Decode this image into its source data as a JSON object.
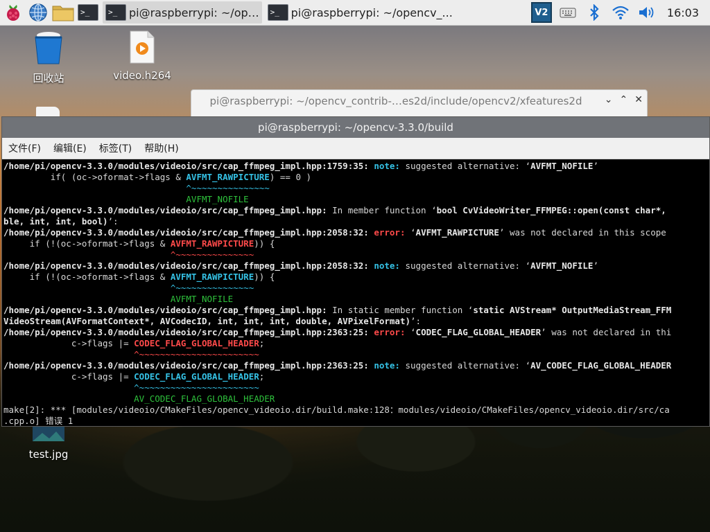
{
  "taskbar": {
    "tasks": [
      {
        "label": "pi@raspberrypi: ~/op…",
        "active": true
      },
      {
        "label": "pi@raspberrypi: ~/opencv_...",
        "active": false
      }
    ],
    "clock": "16:03",
    "icons": [
      "raspberry-menu-icon",
      "web-browser-icon",
      "file-manager-icon",
      "terminal-icon",
      "vnc-icon",
      "keyboard-icon",
      "bluetooth-icon",
      "wifi-icon",
      "volume-icon"
    ]
  },
  "desktop": {
    "icons": [
      {
        "label": "回收站",
        "icon": "trash-icon"
      },
      {
        "label": "video.h264",
        "icon": "video-file-icon"
      },
      {
        "label": "test.jpg",
        "icon": "image-file-icon"
      }
    ]
  },
  "bg_window": {
    "title": "pi@raspberrypi: ~/opencv_contrib-…es2d/include/opencv2/xfeatures2d"
  },
  "terminal": {
    "title": "pi@raspberrypi: ~/opencv-3.3.0/build",
    "menu": [
      "文件(F)",
      "编辑(E)",
      "标签(T)",
      "帮助(H)"
    ],
    "lines": [
      [
        {
          "t": "/home/pi/opencv-3.3.0/modules/videoio/src/cap_ffmpeg_impl.hpp:1759:35: ",
          "c": "b"
        },
        {
          "t": "note:",
          "c": "note"
        },
        {
          "t": " suggested alternative: ‘",
          "c": ""
        },
        {
          "t": "AVFMT_NOFILE",
          "c": "b"
        },
        {
          "t": "’",
          "c": ""
        }
      ],
      [
        {
          "t": "         if( (oc->oformat->flags & ",
          "c": ""
        },
        {
          "t": "AVFMT_RAWPICTURE",
          "c": "hlc"
        },
        {
          "t": ") == 0 )",
          "c": ""
        }
      ],
      [
        {
          "t": "                                   ^~~~~~~~~~~~~~~~",
          "c": "c"
        }
      ],
      [
        {
          "t": "                                   AVFMT_NOFILE",
          "c": "gr"
        }
      ],
      [
        {
          "t": "/home/pi/opencv-3.3.0/modules/videoio/src/cap_ffmpeg_impl.hpp:",
          "c": "b"
        },
        {
          "t": " In member function ‘",
          "c": ""
        },
        {
          "t": "bool CvVideoWriter_FFMPEG::open(const char*, ",
          "c": "b"
        }
      ],
      [
        {
          "t": "ble, int, int, bool)",
          "c": "b"
        },
        {
          "t": "’:",
          "c": ""
        }
      ],
      [
        {
          "t": "/home/pi/opencv-3.3.0/modules/videoio/src/cap_ffmpeg_impl.hpp:2058:32: ",
          "c": "b"
        },
        {
          "t": "error:",
          "c": "err"
        },
        {
          "t": " ‘",
          "c": ""
        },
        {
          "t": "AVFMT_RAWPICTURE",
          "c": "b"
        },
        {
          "t": "’ was not declared in this scope",
          "c": ""
        }
      ],
      [
        {
          "t": "     if (!(oc->oformat->flags & ",
          "c": ""
        },
        {
          "t": "AVFMT_RAWPICTURE",
          "c": "hlr"
        },
        {
          "t": ")) {",
          "c": ""
        }
      ],
      [
        {
          "t": "                                ^~~~~~~~~~~~~~~~",
          "c": "r"
        }
      ],
      [
        {
          "t": "/home/pi/opencv-3.3.0/modules/videoio/src/cap_ffmpeg_impl.hpp:2058:32: ",
          "c": "b"
        },
        {
          "t": "note:",
          "c": "note"
        },
        {
          "t": " suggested alternative: ‘",
          "c": ""
        },
        {
          "t": "AVFMT_NOFILE",
          "c": "b"
        },
        {
          "t": "’",
          "c": ""
        }
      ],
      [
        {
          "t": "     if (!(oc->oformat->flags & ",
          "c": ""
        },
        {
          "t": "AVFMT_RAWPICTURE",
          "c": "hlc"
        },
        {
          "t": ")) {",
          "c": ""
        }
      ],
      [
        {
          "t": "                                ^~~~~~~~~~~~~~~~",
          "c": "c"
        }
      ],
      [
        {
          "t": "                                AVFMT_NOFILE",
          "c": "gr"
        }
      ],
      [
        {
          "t": "/home/pi/opencv-3.3.0/modules/videoio/src/cap_ffmpeg_impl.hpp:",
          "c": "b"
        },
        {
          "t": " In static member function ‘",
          "c": ""
        },
        {
          "t": "static AVStream* OutputMediaStream_FFM",
          "c": "b"
        }
      ],
      [
        {
          "t": "VideoStream(AVFormatContext*, AVCodecID, int, int, int, double, AVPixelFormat)",
          "c": "b"
        },
        {
          "t": "’:",
          "c": ""
        }
      ],
      [
        {
          "t": "/home/pi/opencv-3.3.0/modules/videoio/src/cap_ffmpeg_impl.hpp:2363:25: ",
          "c": "b"
        },
        {
          "t": "error:",
          "c": "err"
        },
        {
          "t": " ‘",
          "c": ""
        },
        {
          "t": "CODEC_FLAG_GLOBAL_HEADER",
          "c": "b"
        },
        {
          "t": "’ was not declared in thi",
          "c": ""
        }
      ],
      [
        {
          "t": "             c->flags |= ",
          "c": ""
        },
        {
          "t": "CODEC_FLAG_GLOBAL_HEADER",
          "c": "hlr"
        },
        {
          "t": ";",
          "c": ""
        }
      ],
      [
        {
          "t": "                         ^~~~~~~~~~~~~~~~~~~~~~~~",
          "c": "r"
        }
      ],
      [
        {
          "t": "/home/pi/opencv-3.3.0/modules/videoio/src/cap_ffmpeg_impl.hpp:2363:25: ",
          "c": "b"
        },
        {
          "t": "note:",
          "c": "note"
        },
        {
          "t": " suggested alternative: ‘",
          "c": ""
        },
        {
          "t": "AV_CODEC_FLAG_GLOBAL_HEADER",
          "c": "b"
        }
      ],
      [
        {
          "t": "             c->flags |= ",
          "c": ""
        },
        {
          "t": "CODEC_FLAG_GLOBAL_HEADER",
          "c": "hlc"
        },
        {
          "t": ";",
          "c": ""
        }
      ],
      [
        {
          "t": "                         ^~~~~~~~~~~~~~~~~~~~~~~~",
          "c": "c"
        }
      ],
      [
        {
          "t": "                         AV_CODEC_FLAG_GLOBAL_HEADER",
          "c": "gr"
        }
      ],
      [
        {
          "t": "make[2]: *** [modules/videoio/CMakeFiles/opencv_videoio.dir/build.make:128：modules/videoio/CMakeFiles/opencv_videoio.dir/src/ca",
          "c": ""
        }
      ],
      [
        {
          "t": ".cpp.o] 错误 1",
          "c": ""
        }
      ]
    ]
  },
  "colors": {
    "note": "#35c2e6",
    "error": "#ff4a4a",
    "fixit": "#2ec23c",
    "terminal_bg": "#000000",
    "title_bar": "#707378"
  }
}
